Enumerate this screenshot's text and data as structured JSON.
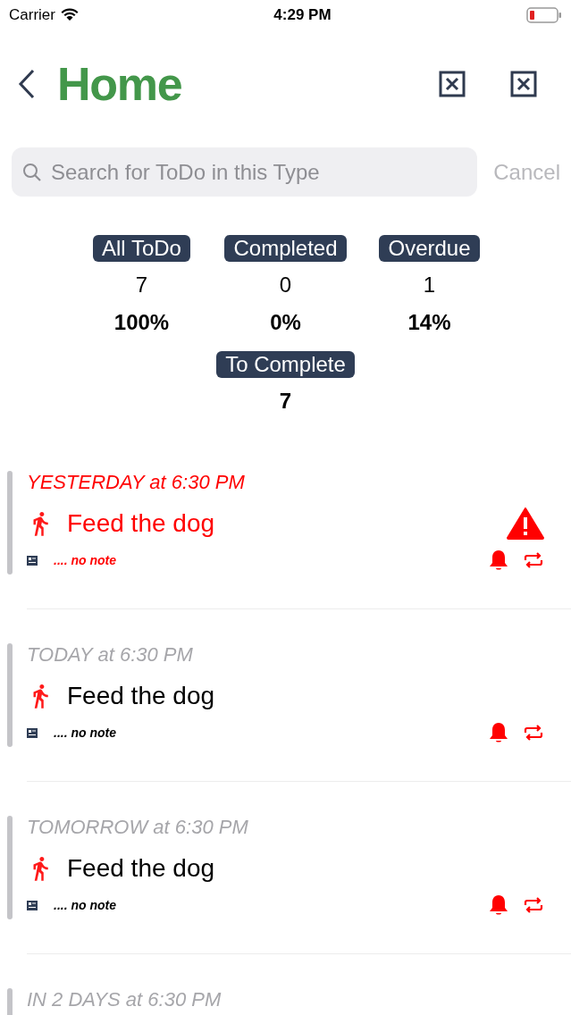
{
  "status_bar": {
    "carrier": "Carrier",
    "time": "4:29 PM"
  },
  "nav": {
    "title": "Home"
  },
  "search": {
    "placeholder": "Search for ToDo in this Type",
    "cancel": "Cancel"
  },
  "stats": [
    {
      "label": "All ToDo",
      "count": "7",
      "percent": "100%"
    },
    {
      "label": "Completed",
      "count": "0",
      "percent": "0%"
    },
    {
      "label": "Overdue",
      "count": "1",
      "percent": "14%"
    }
  ],
  "to_complete": {
    "label": "To Complete",
    "count": "7"
  },
  "todos": [
    {
      "when": "YESTERDAY at 6:30 PM",
      "title": "Feed the dog",
      "note": ".... no note",
      "overdue": true
    },
    {
      "when": "TODAY at 6:30 PM",
      "title": "Feed the dog",
      "note": ".... no note",
      "overdue": false
    },
    {
      "when": "TOMORROW at 6:30 PM",
      "title": "Feed the dog",
      "note": ".... no note",
      "overdue": false
    },
    {
      "when": "IN 2 DAYS at 6:30 PM",
      "overdue": false
    }
  ]
}
